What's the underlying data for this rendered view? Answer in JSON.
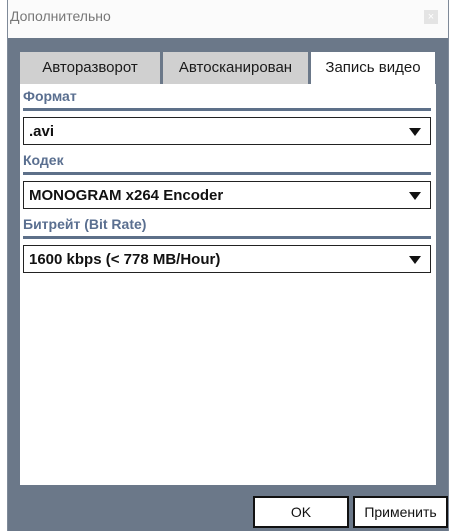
{
  "window": {
    "title": "Дополнительно",
    "close_glyph": "×"
  },
  "tabs": [
    {
      "label": "Авторазворот",
      "active": false
    },
    {
      "label": "Автосканирован",
      "active": false
    },
    {
      "label": "Запись видео",
      "active": true
    }
  ],
  "video": {
    "format": {
      "label": "Формат",
      "value": ".avi"
    },
    "codec": {
      "label": "Кодек",
      "value": "MONOGRAM x264 Encoder"
    },
    "bitrate": {
      "label": "Битрейт (Bit Rate)",
      "value": "1600 kbps (< 778 MB/Hour)"
    }
  },
  "buttons": {
    "ok": "OK",
    "apply": "Применить"
  },
  "colors": {
    "client_background": "#6b7889",
    "section_label": "#5a6f90",
    "section_rule": "#5d7089",
    "tab_inactive": "#d0d0d0"
  }
}
